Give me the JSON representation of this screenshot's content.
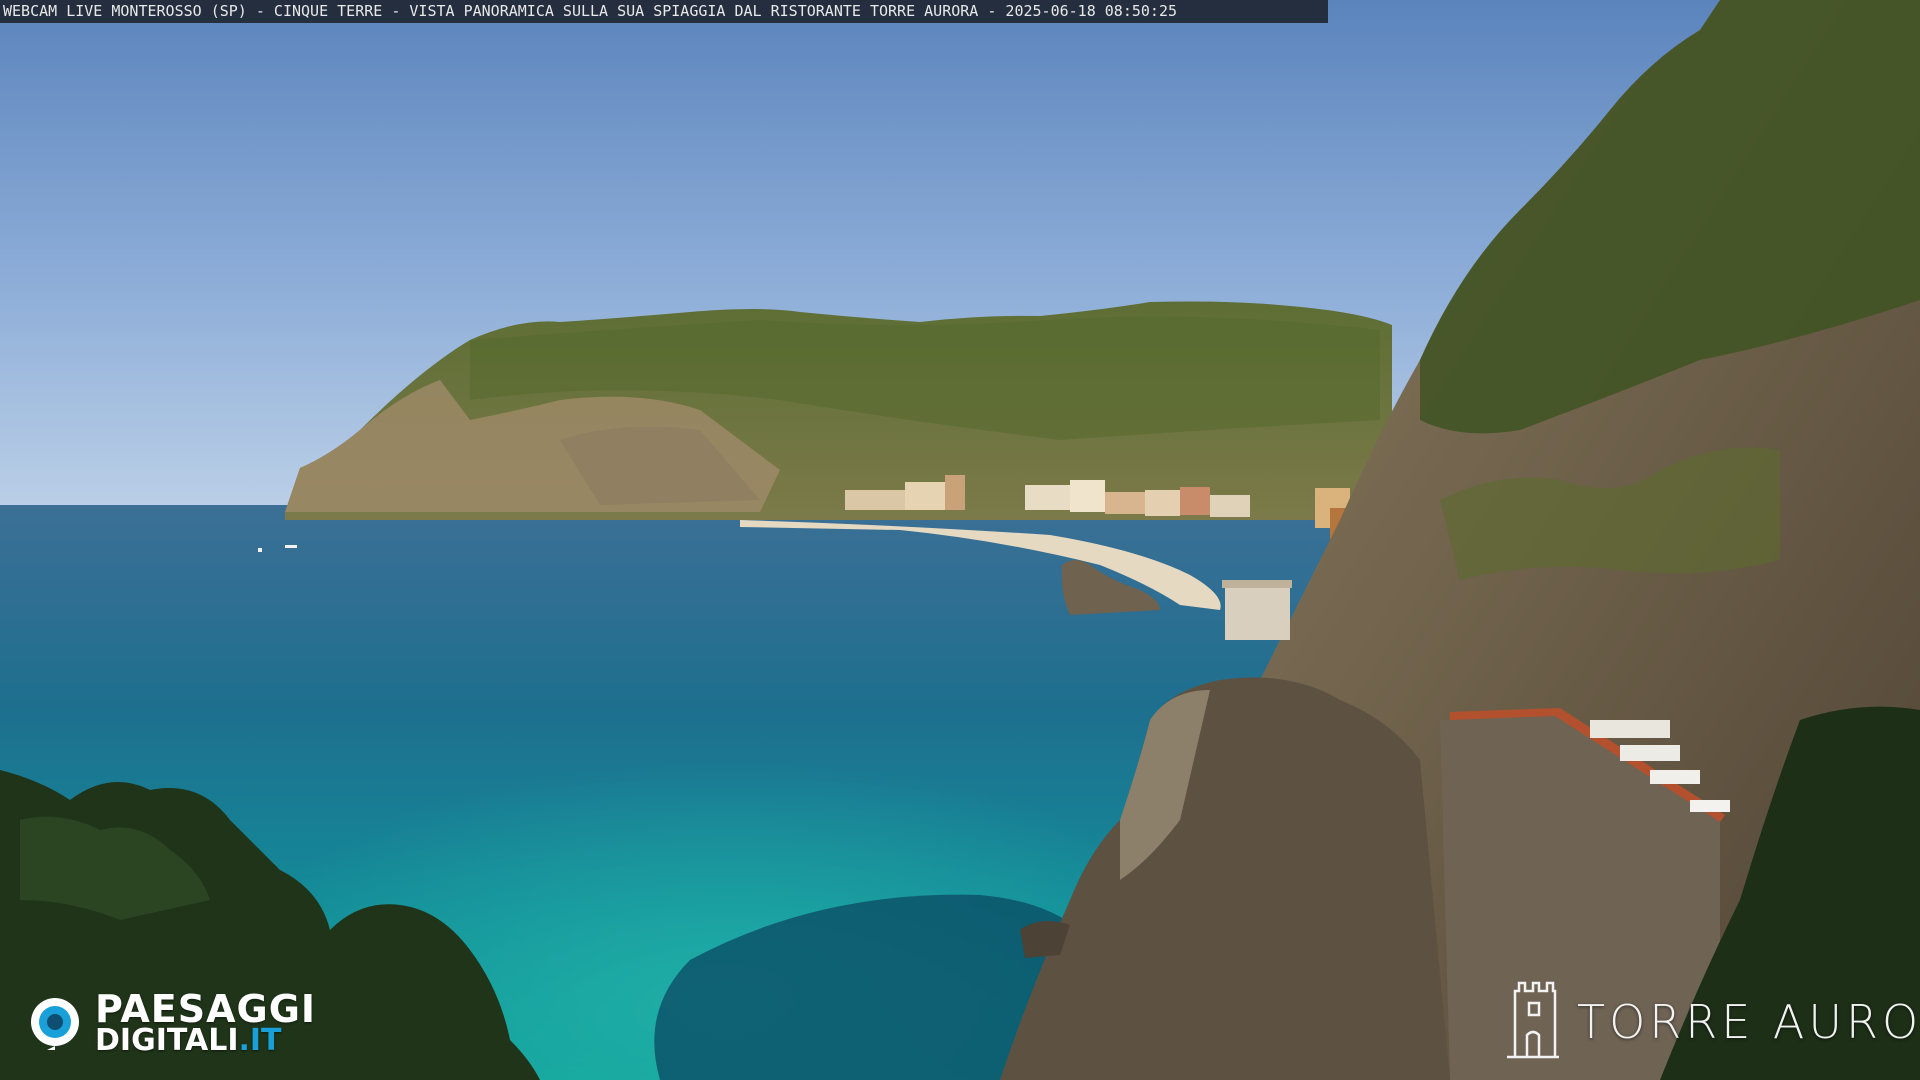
{
  "caption": {
    "text": "WEBCAM LIVE MONTEROSSO (SP) - CINQUE TERRE - VISTA PANORAMICA SULLA SUA SPIAGGIA DAL RISTORANTE TORRE AURORA - 2025-06-18 08:50:25"
  },
  "logos": {
    "paesaggi": {
      "line1": "PAESAGGI",
      "line2": "DIGITALI",
      "line2_tld": ".IT",
      "icon": "eye-icon"
    },
    "torre_aurora": {
      "name": "TORRE AURORA",
      "icon": "tower-icon"
    }
  },
  "colors": {
    "sky_top": "#5f86bd",
    "sky_horizon": "#b9cfe8",
    "sea_deep": "#0c5274",
    "sea_turquoise": "#1fa5a3",
    "hill": "#6b7d3c",
    "cliff": "#7d6a52",
    "accent_tld": "#1aa0d8"
  }
}
